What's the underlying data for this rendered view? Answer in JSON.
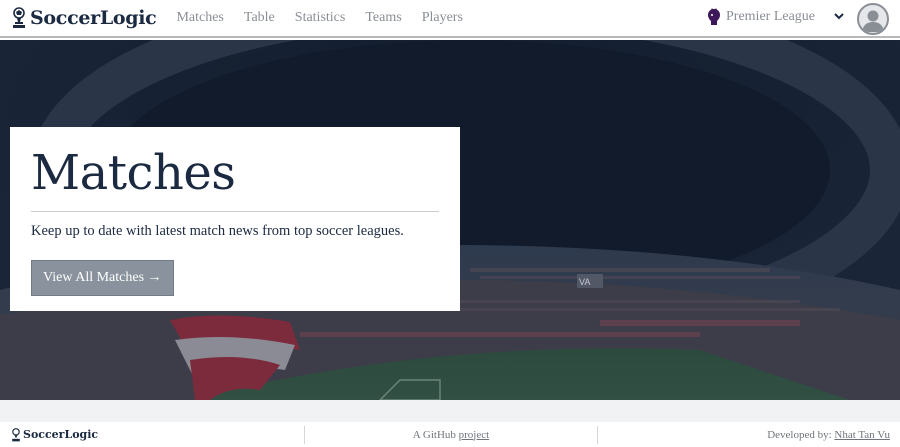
{
  "brand": {
    "name": "SoccerLogic",
    "icon": "trophy-icon"
  },
  "nav": {
    "links": [
      {
        "label": "Matches"
      },
      {
        "label": "Table"
      },
      {
        "label": "Statistics"
      },
      {
        "label": "Teams"
      },
      {
        "label": "Players"
      }
    ],
    "league": {
      "label": "Premier League",
      "icon": "premier-league-lion-icon",
      "caret": "chevron-down-icon"
    },
    "avatar": {
      "icon": "user-avatar-icon"
    }
  },
  "hero": {
    "background": "stadium-photo",
    "title": "Matches",
    "subtitle": "Keep up to date with latest match news from top soccer leagues.",
    "button_label": "View All Matches →"
  },
  "footer": {
    "brand": "SoccerLogic",
    "github_prefix": "A GitHub ",
    "github_link": "project",
    "dev_prefix": "Developed by: ",
    "dev_link": "Nhat Tan Vu"
  },
  "colors": {
    "primary": "#1b2a41",
    "muted": "#8a8f96",
    "button": "#8a939d",
    "hero_overlay": "#1a2638"
  }
}
